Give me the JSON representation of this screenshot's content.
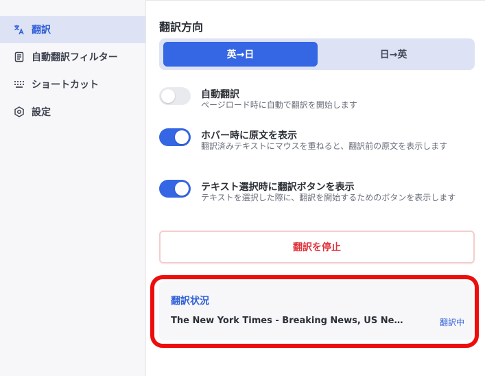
{
  "sidebar": {
    "items": [
      {
        "label": "翻訳",
        "icon": "translate-icon",
        "active": true
      },
      {
        "label": "自動翻訳フィルター",
        "icon": "document-icon",
        "active": false
      },
      {
        "label": "ショートカット",
        "icon": "keyboard-icon",
        "active": false
      },
      {
        "label": "設定",
        "icon": "settings-icon",
        "active": false
      }
    ]
  },
  "main": {
    "direction_title": "翻訳方向",
    "direction": {
      "selected": "英→日",
      "other": "日→英"
    },
    "options": [
      {
        "title": "自動翻訳",
        "desc": "ページロード時に自動で翻訳を開始します",
        "enabled": false
      },
      {
        "title": "ホバー時に原文を表示",
        "desc": "翻訳済みテキストにマウスを重ねると、翻訳前の原文を表示します",
        "enabled": true
      },
      {
        "title": "テキスト選択時に翻訳ボタンを表示",
        "desc": "テキストを選択した際に、翻訳を開始するためのボタンを表示します",
        "enabled": true
      }
    ],
    "stop_button": "翻訳を停止",
    "status": {
      "title": "翻訳状況",
      "page": "The New York Times - Breaking News, US News, World News and Videos",
      "state": "翻訳中"
    }
  },
  "colors": {
    "accent": "#3566e4",
    "danger": "#e0323a",
    "highlight": "#ee0d0d"
  }
}
